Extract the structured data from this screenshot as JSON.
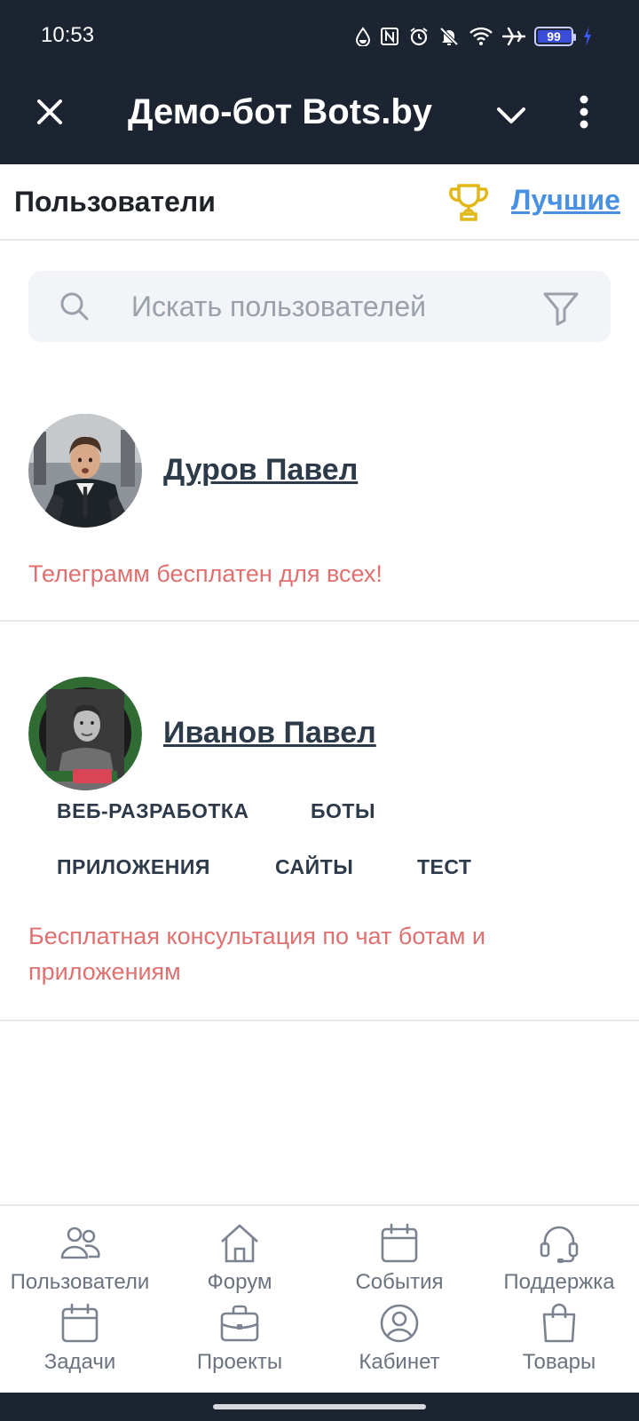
{
  "status_bar": {
    "time": "10:53",
    "battery": "99",
    "icons": [
      "drop-icon",
      "nfc-icon",
      "alarm-icon",
      "bell-off-icon",
      "wifi-icon",
      "airplane-icon",
      "battery-icon",
      "charging-icon"
    ]
  },
  "app_bar": {
    "title": "Демо-бот Bots.by",
    "icons": [
      "close-icon",
      "chevron-down-icon",
      "more-vertical-icon"
    ]
  },
  "section": {
    "title": "Пользователи",
    "best_link": "Лучшие",
    "trophy_color": "#e2b719"
  },
  "search": {
    "placeholder": "Искать пользователей",
    "value": ""
  },
  "users": [
    {
      "name": "Дуров Павел",
      "status": "Телеграмм бесплатен для всех!",
      "tags": []
    },
    {
      "name": "Иванов Павел",
      "status": "Бесплатная консультация по чат ботам и приложениям",
      "avatar_badge": [
        "#OPENTO",
        "ROCK"
      ],
      "tags": [
        "ВЕБ-РАЗРАБОТКА",
        "БОТЫ",
        "ПРИЛОЖЕНИЯ",
        "САЙТЫ",
        "ТЕСТ"
      ]
    }
  ],
  "bottom_nav": [
    {
      "label": "Пользователи",
      "icon": "users-icon"
    },
    {
      "label": "Форум",
      "icon": "home-icon"
    },
    {
      "label": "События",
      "icon": "calendar-icon"
    },
    {
      "label": "Поддержка",
      "icon": "headset-icon"
    },
    {
      "label": "Задачи",
      "icon": "calendar-icon"
    },
    {
      "label": "Проекты",
      "icon": "briefcase-icon"
    },
    {
      "label": "Кабинет",
      "icon": "account-icon"
    },
    {
      "label": "Товары",
      "icon": "shopping-bag-icon"
    }
  ],
  "colors": {
    "header_bg": "#1c2331",
    "link": "#4a90e2",
    "status_text": "#e07070",
    "name_text": "#2d3a4a"
  }
}
